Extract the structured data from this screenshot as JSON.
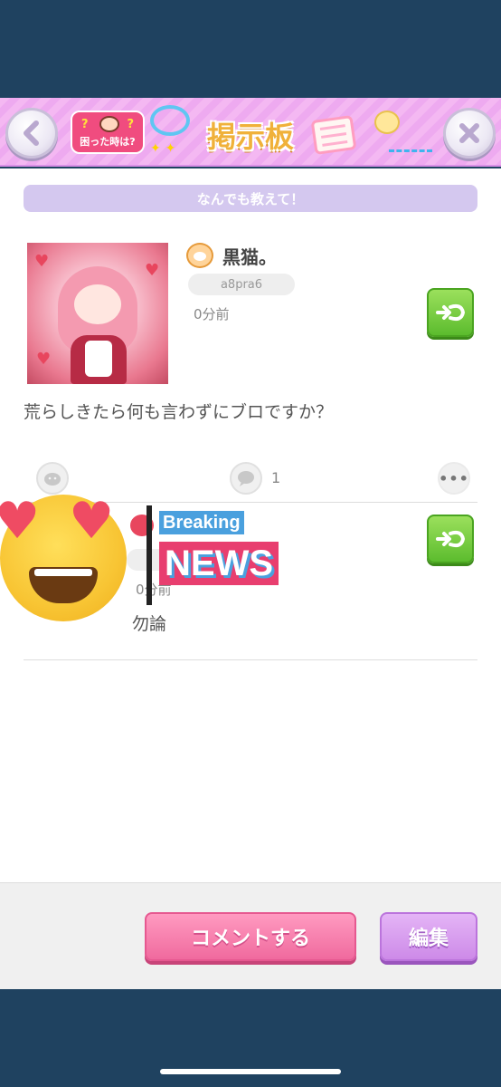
{
  "header": {
    "title": "掲示板",
    "help_label": "困った時は?",
    "help_marks": "?"
  },
  "category": "なんでも教えて！",
  "post": {
    "username": "黒猫。",
    "user_id": "a8pra6",
    "time": "0分前",
    "body": "荒らしきたら何も言わずにブロですか？",
    "comment_count": "1",
    "more": "•••"
  },
  "comment": {
    "time": "0分前",
    "body": "勿論"
  },
  "overlay": {
    "breaking_top": "Breaking",
    "breaking_main": "NEWS"
  },
  "footer": {
    "comment_button": "コメントする",
    "edit_button": "編集"
  },
  "colors": {
    "background": "#1f4260",
    "header_pink": "#f4b8f2",
    "category_purple": "#d4c8ef",
    "comment_button": "#f06a9e",
    "edit_button": "#cd8ae8",
    "reply_green": "#5cbc2e"
  }
}
